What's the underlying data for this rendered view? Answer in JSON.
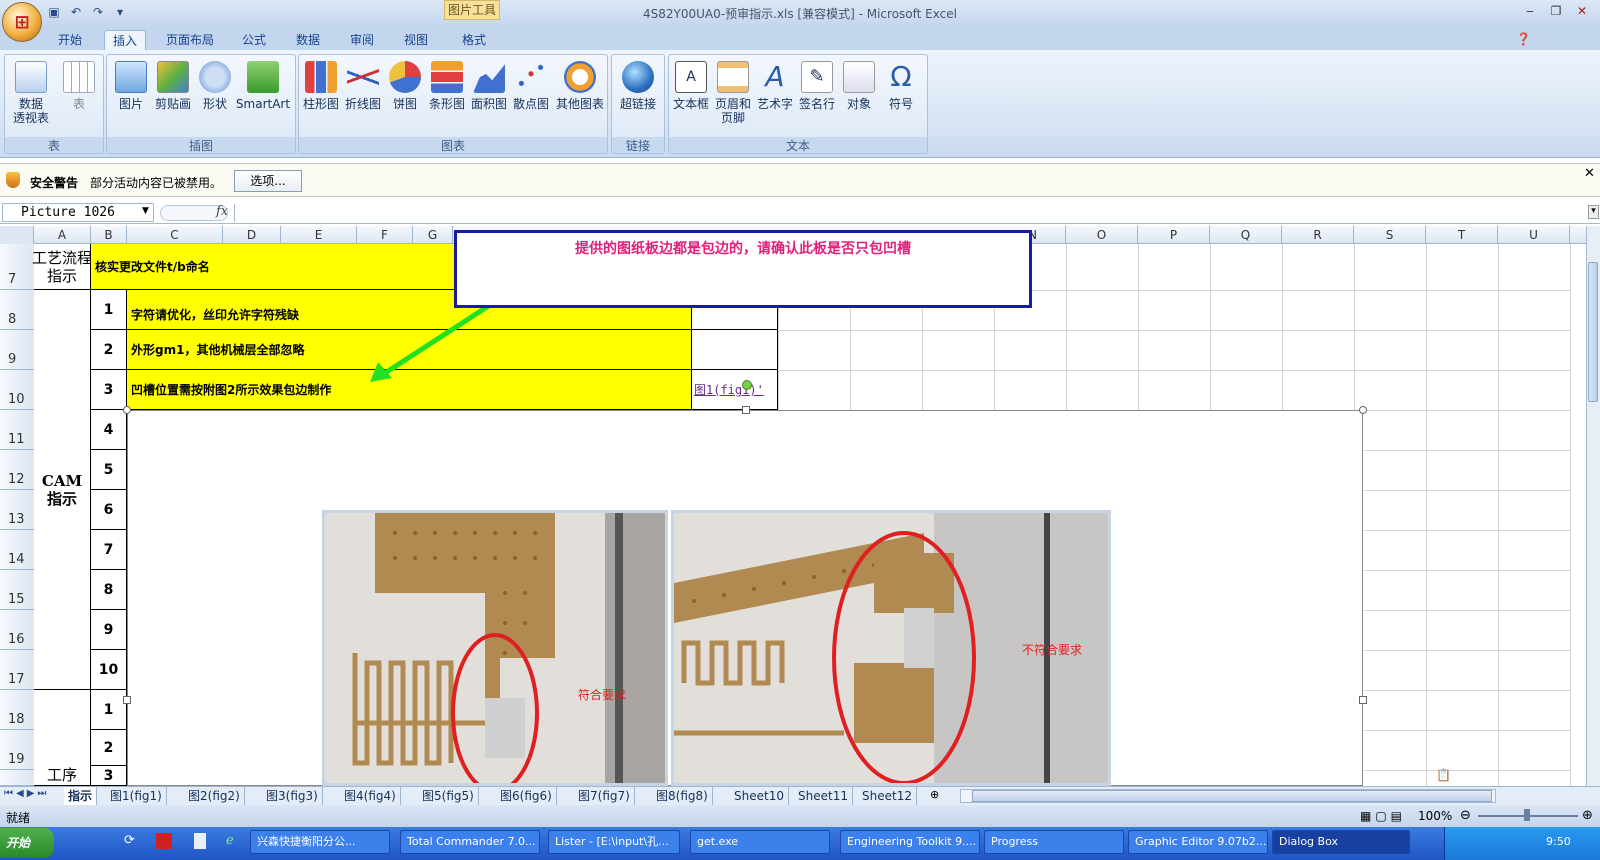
{
  "window": {
    "title": "4S82Y00UA0-预审指示.xls  [兼容模式] - Microsoft Excel",
    "context_tab": "图片工具"
  },
  "tabs": [
    "开始",
    "插入",
    "页面布局",
    "公式",
    "数据",
    "审阅",
    "视图",
    "格式"
  ],
  "ribbon": {
    "groups": [
      {
        "label": "表",
        "buttons": [
          "数据\n透视表",
          "表"
        ]
      },
      {
        "label": "插图",
        "buttons": [
          "图片",
          "剪贴画",
          "形状",
          "SmartArt"
        ]
      },
      {
        "label": "图表",
        "buttons": [
          "柱形图",
          "折线图",
          "饼图",
          "条形图",
          "面积图",
          "散点图",
          "其他图表"
        ]
      },
      {
        "label": "链接",
        "buttons": [
          "超链接"
        ]
      },
      {
        "label": "文本",
        "buttons": [
          "文本框",
          "页眉和\n页脚",
          "艺术字",
          "签名行",
          "对象",
          "符号"
        ]
      }
    ]
  },
  "security": {
    "title": "安全警告",
    "message": "部分活动内容已被禁用。",
    "options_button": "选项..."
  },
  "formula_bar": {
    "name_box": "Picture 1026",
    "fx": "fx",
    "formula": ""
  },
  "columns": [
    "A",
    "B",
    "C",
    "D",
    "E",
    "F",
    "G",
    "N",
    "O",
    "P",
    "Q",
    "R",
    "S",
    "T",
    "U"
  ],
  "rows": [
    "7",
    "8",
    "9",
    "10",
    "11",
    "12",
    "13",
    "14",
    "15",
    "16",
    "17",
    "18",
    "19"
  ],
  "sheet": {
    "process_label": "工艺流程\n指示",
    "c7": "核实更改文件t/b命名",
    "cam_label": "CAM\n指示",
    "procedure_label": "工序",
    "numbers": [
      "1",
      "2",
      "3",
      "4",
      "5",
      "6",
      "7",
      "8",
      "9",
      "10"
    ],
    "numbers2": [
      "1",
      "2",
      "3"
    ],
    "items": [
      "字符请优化，丝印允许字符残缺",
      "外形gm1，其他机械层全部忽略",
      "凹槽位置需按附图2所示效果包边制作"
    ],
    "link": "图1(fig1)'"
  },
  "callout": "提供的图纸板边都是包边的，请确认此板是否只包凹槽",
  "photo_labels": {
    "left": "符合要求",
    "right": "不符合要求"
  },
  "sheet_tabs": [
    "指示",
    "图1(fig1)",
    "图2(fig2)",
    "图3(fig3)",
    "图4(fig4)",
    "图5(fig5)",
    "图6(fig6)",
    "图7(fig7)",
    "图8(fig8)",
    "Sheet10",
    "Sheet11",
    "Sheet12"
  ],
  "status": {
    "ready": "就绪",
    "zoom": "100%"
  },
  "taskbar": {
    "start": "开始",
    "items": [
      "兴森快捷衡阳分公...",
      "Total Commander 7.0...",
      "Lister - [E:\\input\\孔...",
      "get.exe",
      "Engineering Toolkit 9....",
      "Progress",
      "Graphic Editor 9.07b2...",
      "Dialog Box"
    ],
    "clock": "9:50"
  },
  "colors": {
    "yellow": "#ffff00",
    "callout_border": "#1a1aa8",
    "callout_text": "#e0207a",
    "arrow": "#22e022",
    "ellipse": "#e02020"
  }
}
